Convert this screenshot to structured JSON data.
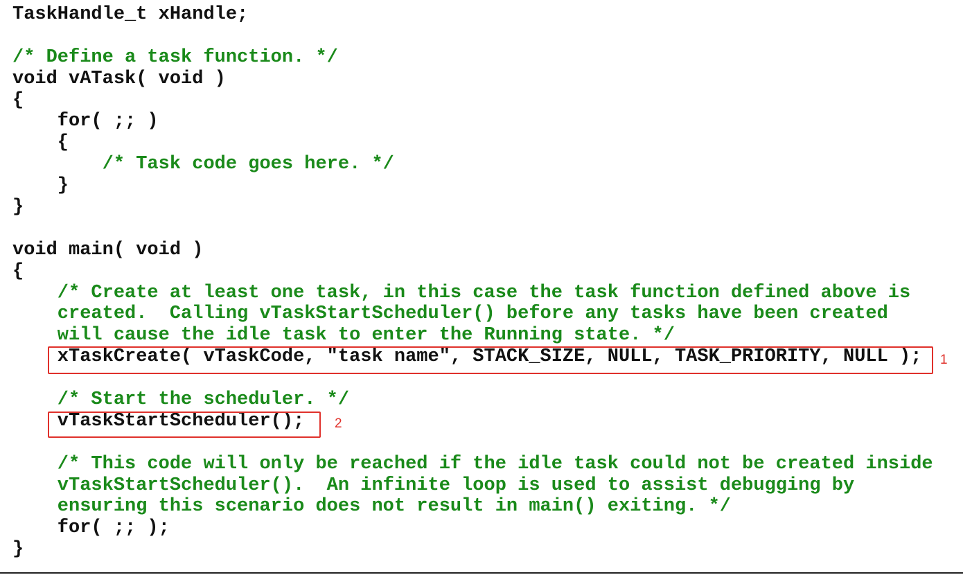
{
  "code_lines": [
    {
      "text": "TaskHandle_t xHandle;",
      "type": "code"
    },
    {
      "text": "",
      "type": "code"
    },
    {
      "text": "/* Define a task function. */",
      "type": "comment"
    },
    {
      "text": "void vATask( void )",
      "type": "code"
    },
    {
      "text": "{",
      "type": "code"
    },
    {
      "text": "    for( ;; )",
      "type": "code"
    },
    {
      "text": "    {",
      "type": "code"
    },
    {
      "text": "        /* Task code goes here. */",
      "type": "comment"
    },
    {
      "text": "    }",
      "type": "code"
    },
    {
      "text": "}",
      "type": "code"
    },
    {
      "text": "",
      "type": "code"
    },
    {
      "text": "void main( void )",
      "type": "code"
    },
    {
      "text": "{",
      "type": "code"
    },
    {
      "text": "    /* Create at least one task, in this case the task function defined above is",
      "type": "comment"
    },
    {
      "text": "    created.  Calling vTaskStartScheduler() before any tasks have been created",
      "type": "comment"
    },
    {
      "text": "    will cause the idle task to enter the Running state. */",
      "type": "comment"
    },
    {
      "text": "    xTaskCreate( vTaskCode, \"task name\", STACK_SIZE, NULL, TASK_PRIORITY, NULL );",
      "type": "code"
    },
    {
      "text": "",
      "type": "code"
    },
    {
      "text": "    /* Start the scheduler. */",
      "type": "comment"
    },
    {
      "text": "    vTaskStartScheduler();",
      "type": "code"
    },
    {
      "text": "",
      "type": "code"
    },
    {
      "text": "    /* This code will only be reached if the idle task could not be created inside",
      "type": "comment"
    },
    {
      "text": "    vTaskStartScheduler().  An infinite loop is used to assist debugging by",
      "type": "comment"
    },
    {
      "text": "    ensuring this scenario does not result in main() exiting. */",
      "type": "comment"
    },
    {
      "text": "    for( ;; );",
      "type": "code"
    },
    {
      "text": "}",
      "type": "code"
    }
  ],
  "annotations": [
    {
      "label": "1",
      "target": "xTaskCreate( vTaskCode, \"task name\", STACK_SIZE, NULL, TASK_PRIORITY, NULL );"
    },
    {
      "label": "2",
      "target": "vTaskStartScheduler();"
    }
  ],
  "colors": {
    "code": "#111111",
    "comment": "#1a8a1a",
    "highlight_box": "#e0312b"
  }
}
